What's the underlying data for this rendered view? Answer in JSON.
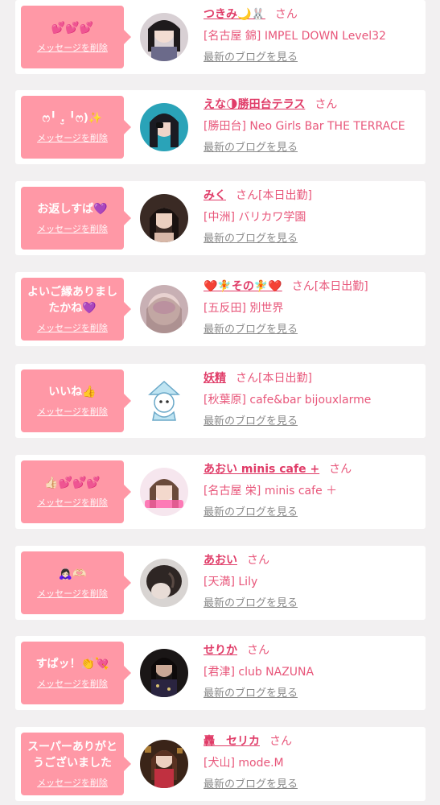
{
  "colors": {
    "bubble": "#ff98a6",
    "accent": "#e8567a",
    "background": "#f2f0f1"
  },
  "items": [
    {
      "message": "💕💕💕",
      "delete_label": "メッセージを削除",
      "name": "つきみ🌙🐰",
      "honorific": "さん",
      "status": "",
      "shop": "[名古屋 錦] IMPEL DOWN Level32",
      "blog_link": "最新のブログを見る"
    },
    {
      "message": "ෆ╹ .̮ ╹ෆ)✨",
      "delete_label": "メッセージを削除",
      "name": "えな🌗勝田台テラス",
      "honorific": "さん",
      "status": "",
      "shop": "[勝田台] Neo Girls Bar THE TERRACE",
      "blog_link": "最新のブログを見る"
    },
    {
      "message": "お返しすぱ💜",
      "delete_label": "メッセージを削除",
      "name": "みく",
      "honorific": "さん",
      "status": "[本日出勤]",
      "shop": "[中洲] バリカワ学園",
      "blog_link": "最新のブログを見る"
    },
    {
      "message": "よいご縁ありましたかね💜",
      "delete_label": "メッセージを削除",
      "name": "❤️🧚その🧚❤️",
      "honorific": "さん",
      "status": "[本日出勤]",
      "shop": "[五反田] 別世界",
      "blog_link": "最新のブログを見る"
    },
    {
      "message": "いいね👍",
      "delete_label": "メッセージを削除",
      "name": "妖精",
      "honorific": "さん",
      "status": "[本日出勤]",
      "shop": "[秋葉原] cafe&bar bijouxlarme",
      "blog_link": "最新のブログを見る"
    },
    {
      "message": "👍🏻💕💕💕",
      "delete_label": "メッセージを削除",
      "name": "あおい minis cafe +",
      "honorific": "さん",
      "status": "",
      "shop": "[名古屋 栄] minis cafe ＋",
      "blog_link": "最新のブログを見る"
    },
    {
      "message": "🙇🏻‍♀️🫶🏻",
      "delete_label": "メッセージを削除",
      "name": "あおい",
      "honorific": "さん",
      "status": "",
      "shop": "[天満] Lily",
      "blog_link": "最新のブログを見る"
    },
    {
      "message": "すぱッ！👏💘",
      "delete_label": "メッセージを削除",
      "name": "せりか",
      "honorific": "さん",
      "status": "",
      "shop": "[君津] club NAZUNA",
      "blog_link": "最新のブログを見る"
    },
    {
      "message": "スーパーありがとうございました",
      "delete_label": "メッセージを削除",
      "name": "轟　セリカ",
      "honorific": "さん",
      "status": "",
      "shop": "[犬山] mode.M",
      "blog_link": "最新のブログを見る"
    }
  ]
}
